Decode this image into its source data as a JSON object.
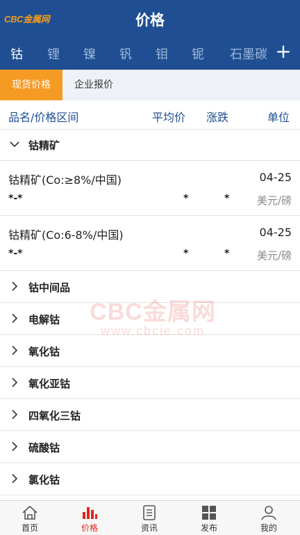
{
  "header": {
    "logo": "CBC金属网",
    "title": "价格"
  },
  "metal_tabs": [
    "钴",
    "锂",
    "镍",
    "钒",
    "钼",
    "铌",
    "石墨碳"
  ],
  "add_label": "+",
  "sub_tabs": {
    "active": "现货价格",
    "other": "企业报价"
  },
  "columns": {
    "name": "品名/价格区间",
    "avg": "平均价",
    "change": "涨跌",
    "unit": "单位"
  },
  "expanded_group": "钴精矿",
  "items": [
    {
      "name": "钴精矿(Co:≥8%/中国)",
      "date": "04-25",
      "range": "*-*",
      "avg": "*",
      "change": "*",
      "unit": "美元/磅"
    },
    {
      "name": "钴精矿(Co:6-8%/中国)",
      "date": "04-25",
      "range": "*-*",
      "avg": "*",
      "change": "*",
      "unit": "美元/磅"
    }
  ],
  "groups": [
    "钴中间品",
    "电解钴",
    "氧化钴",
    "氧化亚钴",
    "四氧化三钴",
    "硫酸钴",
    "氯化钴"
  ],
  "watermark": {
    "line1": "CBC金属网",
    "line2": "www.cbcie.com"
  },
  "bottom_nav": {
    "home": "首页",
    "price": "价格",
    "news": "资讯",
    "publish": "发布",
    "mine": "我的"
  },
  "colors": {
    "primary": "#1f4f92",
    "accent": "#f59a23",
    "active_red": "#e1261c"
  }
}
